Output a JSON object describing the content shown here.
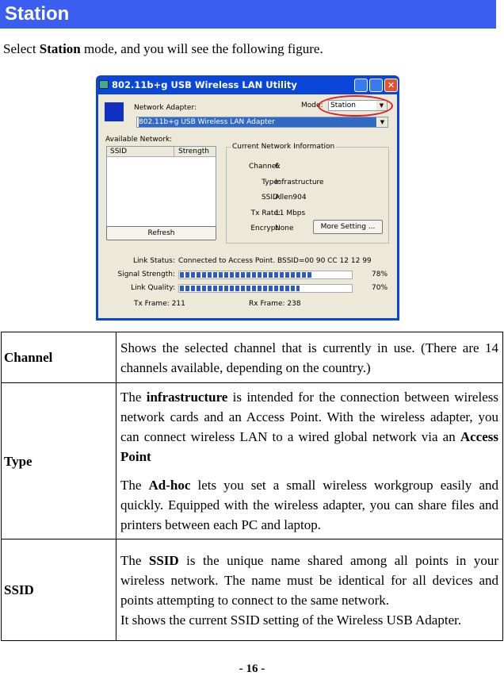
{
  "heading": "Station",
  "intro": {
    "pre": "Select ",
    "bold": "Station",
    "post": " mode, and you will see the following figure."
  },
  "window": {
    "title": "802.11b+g USB Wireless LAN Utility",
    "network_adapter_label": "Network Adapter:",
    "mode_label": "Mode:",
    "mode_value": "Station",
    "adapter_value": "802.11b+g USB Wireless LAN Adapter",
    "available_network_label": "Available Network:",
    "columns": [
      "SSID",
      "Strength"
    ],
    "refresh": "Refresh",
    "info_title": "Current Network Information",
    "info": [
      {
        "label": "Channel:",
        "value": "6"
      },
      {
        "label": "Type:",
        "value": "Infrastructure"
      },
      {
        "label": "SSID:",
        "value": "Allen904"
      },
      {
        "label": "Tx Rate:",
        "value": "11 Mbps"
      },
      {
        "label": "Encrypt:",
        "value": "None"
      }
    ],
    "more_setting": "More Setting ...",
    "link_status_label": "Link Status:",
    "link_status": "Connected to Access Point. BSSID=00 90 CC 12 12 99",
    "signal_label": "Signal Strength:",
    "signal_pct": 78,
    "signal_text": "78%",
    "quality_label": "Link Quality:",
    "quality_pct": 70,
    "quality_text": "70%",
    "tx_label": "Tx Frame:",
    "tx": "211",
    "rx_label": "Rx Frame:",
    "rx": "238",
    "highlight_color": "#e02020"
  },
  "table": {
    "channel": {
      "key": "Channel",
      "text": "Shows the selected channel that is currently in use. (There are 14 channels available, depending on the country.)"
    },
    "type": {
      "key": "Type",
      "p1a": "The ",
      "p1b": "infrastructure",
      "p1c": " is intended for the connection between wireless network cards and an Access Point. With the wireless adapter, you can connect wireless LAN to a wired global network via an ",
      "p1d": "Access Point",
      "p2a": "The ",
      "p2b": "Ad-hoc",
      "p2c": " lets you set a small wireless workgroup easily and quickly.  Equipped with the wireless adapter, you can share files and printers between each PC and laptop."
    },
    "ssid": {
      "key": "SSID",
      "p1a": "The ",
      "p1b": "SSID",
      "p1c": " is the unique name shared among all points in your wireless network. The name must be identical for all devices and points attempting to connect to the same network.",
      "p2": "It shows the current SSID setting of the Wireless USB Adapter."
    }
  },
  "page_number": "- 16 -"
}
